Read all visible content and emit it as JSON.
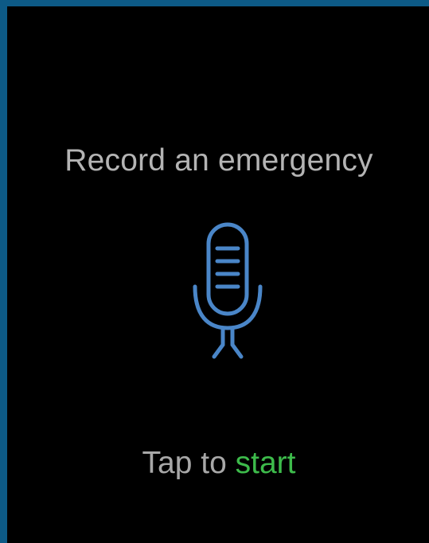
{
  "screen": {
    "title": "Record an emergency",
    "prompt_prefix": "Tap to ",
    "prompt_action": "start"
  },
  "icons": {
    "microphone": "microphone-icon"
  },
  "colors": {
    "frame": "#0d5a86",
    "background": "#000000",
    "text": "#b4b4b4",
    "mic": "#4a86c8",
    "action": "#3dbb4b"
  }
}
